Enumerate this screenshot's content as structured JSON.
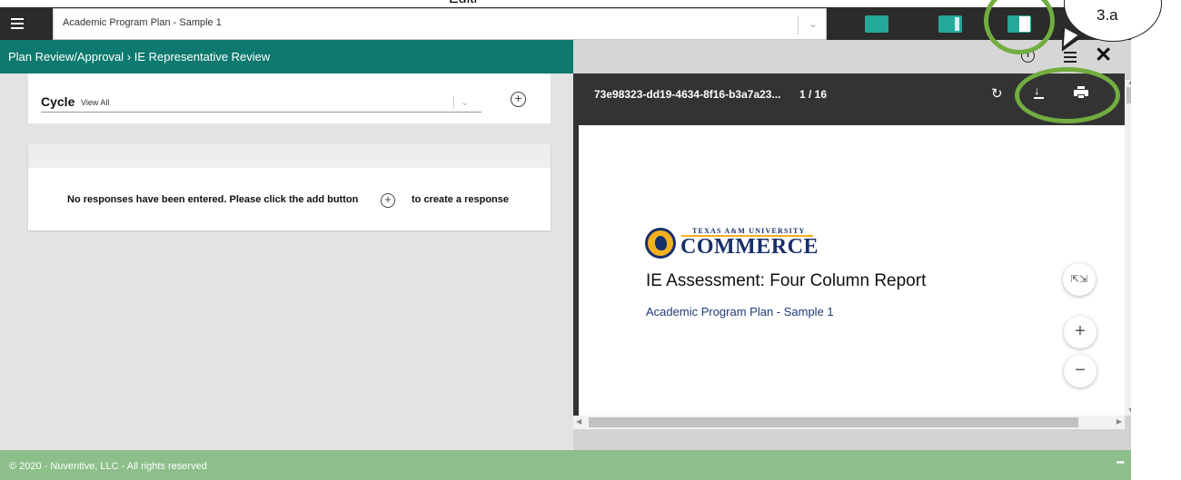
{
  "header": {
    "overlay_text": "Editi",
    "plan_select": {
      "value": "Academic Program Plan - Sample 1",
      "chevron": "chevron-down-icon"
    },
    "layout_buttons": [
      "layout-left-icon",
      "layout-right-panel-icon",
      "layout-split-icon"
    ]
  },
  "callout": {
    "label": "3.a"
  },
  "breadcrumb": {
    "text": "Plan Review/Approval  ›  IE Representative Review"
  },
  "viewer_header": {
    "info": "i",
    "close": "✕"
  },
  "cycle": {
    "label": "Cycle",
    "value": "View All"
  },
  "responses": {
    "empty_message": "No responses have been entered. Please click the add button",
    "empty_message_suffix": "to create a response"
  },
  "pdf": {
    "file_name": "73e98323-dd19-4634-8f16-b3a7a23...",
    "page_indicator": "1 / 16",
    "logo_small": "TEXAS A&M UNIVERSITY",
    "logo_big": "COMMERCE",
    "doc_title": "IE Assessment: Four Column Report",
    "doc_subtitle": "Academic Program Plan - Sample 1"
  },
  "footer": {
    "copyright": "© 2020 - Nuventive, LLC - All rights reserved",
    "more": "•••"
  },
  "colors": {
    "brand_teal": "#0e7a6f",
    "accent_teal": "#25a89a",
    "footer_green": "#8cbf8a",
    "highlight": "#72ad3f",
    "pdf_bar": "#333333"
  }
}
